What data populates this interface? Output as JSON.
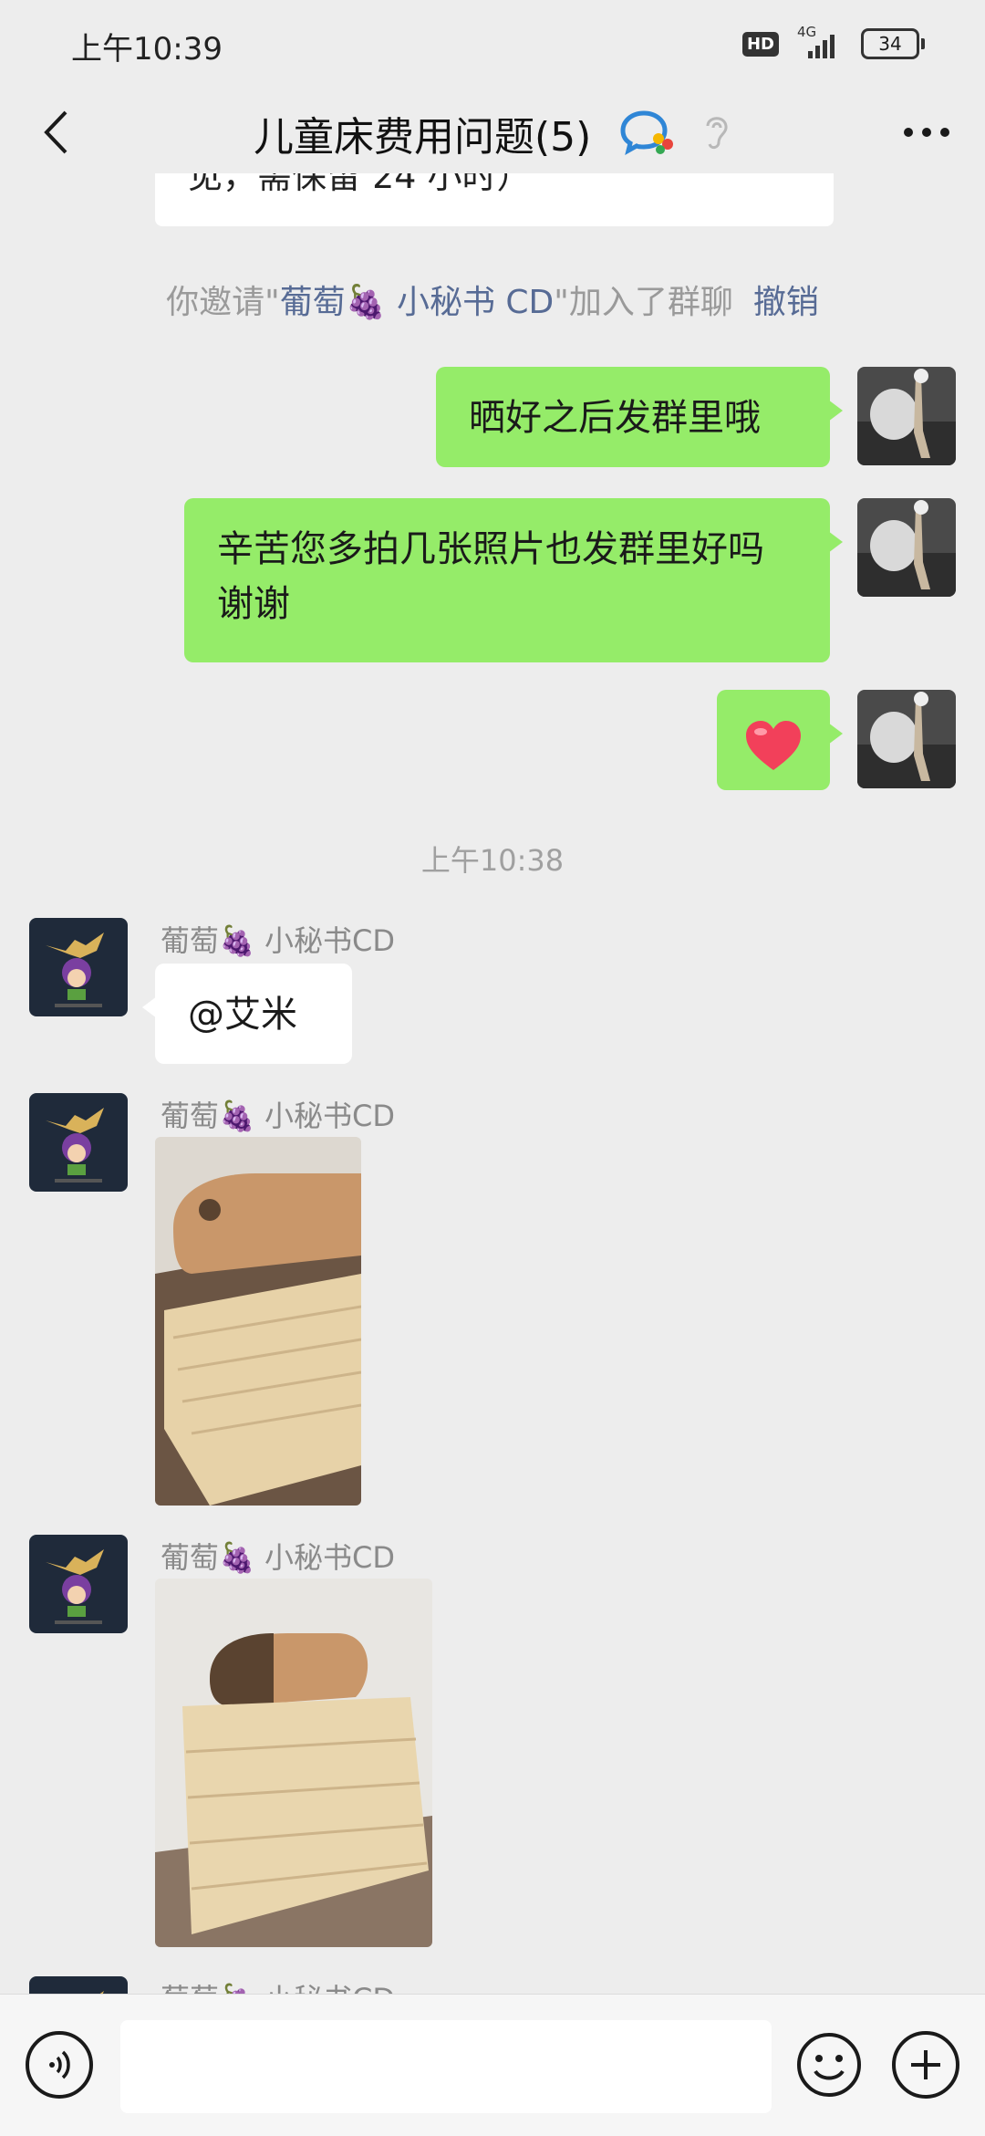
{
  "status_bar": {
    "time": "上午10:39",
    "hd_label": "HD",
    "network": "4G",
    "battery": "34"
  },
  "header": {
    "title": "儿童床费用问题(5)",
    "back_icon": "chevron-left-icon",
    "more_icon": "more-dots-icon"
  },
  "messages": {
    "partial_text": "见，需保留 24 小时）",
    "system": {
      "prefix": "你邀请\"",
      "name": "葡萄🍇 小秘书 CD",
      "suffix": "\"加入了群聊",
      "undo": "撤销"
    },
    "out1": "晒好之后发群里哦",
    "out2": "辛苦您多拍几张照片也发群里好吗 谢谢",
    "out3_emoji": "heart",
    "time_divider": "上午10:38",
    "sender_name": "葡萄🍇 小秘书CD",
    "in1": "@艾米"
  },
  "colors": {
    "background": "#ededed",
    "bubble_self": "#95ec69",
    "bubble_other": "#ffffff",
    "link": "#576b95"
  }
}
